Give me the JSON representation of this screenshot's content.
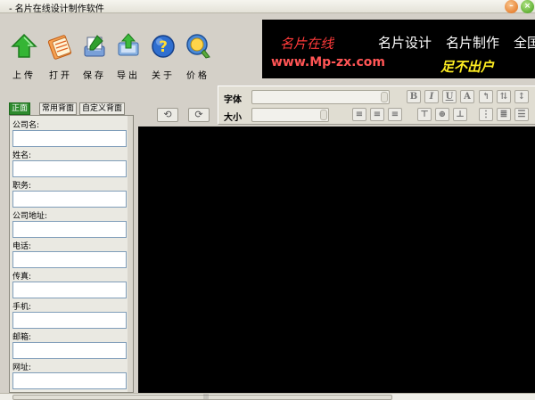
{
  "window": {
    "title": "- 名片在线设计制作软件"
  },
  "toolbar": {
    "items": [
      {
        "label": "上传",
        "icon": "upload-arrow-icon"
      },
      {
        "label": "打开",
        "icon": "open-folder-icon"
      },
      {
        "label": "保存",
        "icon": "save-icon"
      },
      {
        "label": "导出",
        "icon": "export-icon"
      },
      {
        "label": "关于",
        "icon": "help-icon"
      },
      {
        "label": "价格",
        "icon": "price-icon"
      }
    ]
  },
  "banner": {
    "slogan": "名片在线",
    "item1": "名片设计",
    "item2": "名片制作",
    "item3": "全国",
    "url": "www.Mp-zx.com",
    "tagline": "足不出户"
  },
  "fontpanel": {
    "font_label": "字体",
    "size_label": "大小"
  },
  "format_buttons": [
    "B",
    "I",
    "U",
    "A"
  ],
  "tabs": [
    "正面",
    "常用背面",
    "自定义背面"
  ],
  "form": {
    "fields": [
      {
        "label": "公司名:",
        "value": ""
      },
      {
        "label": "姓名:",
        "value": ""
      },
      {
        "label": "职务:",
        "value": ""
      },
      {
        "label": "公司地址:",
        "value": ""
      },
      {
        "label": "电话:",
        "value": ""
      },
      {
        "label": "传真:",
        "value": ""
      },
      {
        "label": "手机:",
        "value": ""
      },
      {
        "label": "邮箱:",
        "value": ""
      },
      {
        "label": "网址:",
        "value": ""
      }
    ]
  },
  "colors": {
    "accent_green": "#2e8b2e",
    "canvas": "#000000",
    "banner_red": "#ff3a3a",
    "banner_yellow": "#ffee22"
  }
}
